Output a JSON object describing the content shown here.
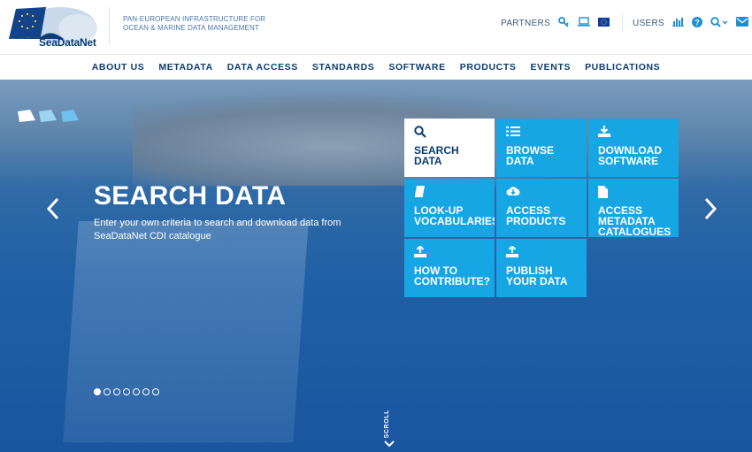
{
  "brand": {
    "logo_text": "SeaDataNet",
    "tagline_line1": "PAN-EUROPEAN INFRASTRUCTURE FOR",
    "tagline_line2": "OCEAN & MARINE DATA MANAGEMENT"
  },
  "top_right": {
    "partners_label": "PARTNERS",
    "users_label": "USERS"
  },
  "nav": {
    "items": [
      "ABOUT US",
      "METADATA",
      "DATA ACCESS",
      "STANDARDS",
      "SOFTWARE",
      "PRODUCTS",
      "EVENTS",
      "PUBLICATIONS"
    ]
  },
  "hero": {
    "title": "SEARCH DATA",
    "description": "Enter your own criteria to search and download data from SeaDataNet CDI catalogue",
    "scroll_label": "SCROLL",
    "slides_count": 7,
    "active_slide": 1
  },
  "tiles": [
    {
      "label": "SEARCH\nDATA",
      "icon": "search-icon"
    },
    {
      "label": "BROWSE\nDATA",
      "icon": "list-icon"
    },
    {
      "label": "DOWNLOAD\nSOFTWARE",
      "icon": "download-icon"
    },
    {
      "label": "LOOK-UP\nVOCABULARIES",
      "icon": "book-icon"
    },
    {
      "label": "ACCESS\nPRODUCTS",
      "icon": "cloud-download-icon"
    },
    {
      "label": "ACCESS\nMETADATA\nCATALOGUES",
      "icon": "file-icon"
    },
    {
      "label": "HOW TO\nCONTRIBUTE?",
      "icon": "upload-icon"
    },
    {
      "label": "PUBLISH\nYOUR DATA",
      "icon": "upload-icon"
    }
  ],
  "colors": {
    "tile": "#17a6e4",
    "nav_text": "#0b3c6f",
    "accent": "#1c8fd6"
  }
}
